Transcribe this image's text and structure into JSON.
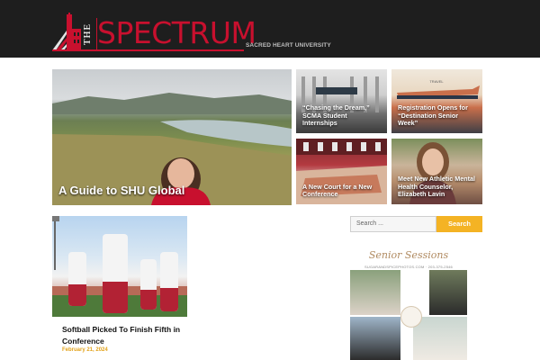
{
  "site": {
    "logo_the": "THE",
    "logo_name": "SPECTRUM",
    "logo_sub": "SACRED HEART UNIVERSITY",
    "accent": "#c8102e",
    "header_bg": "#1e1e1e"
  },
  "featured": {
    "main": {
      "caption": "A Guide to SHU Global"
    },
    "tiles": [
      {
        "caption": "“Chasing the Dream,” SCMA Student Internships"
      },
      {
        "caption": "Registration Opens for “Destination Senior Week”"
      },
      {
        "caption": "A New Court for a New Conference"
      },
      {
        "caption": "Meet New Athletic Mental Health Counselor, Elizabeth Lavin"
      }
    ]
  },
  "post": {
    "title": "Softball Picked To Finish Fifth in Conference",
    "date": "February 21, 2024",
    "date_color": "#e2a21a"
  },
  "sidebar": {
    "search_placeholder": "Search ...",
    "search_button": "Search",
    "search_button_color": "#f4b324",
    "ad_title": "Senior Sessions",
    "ad_sub": "SUGARANDSPICEPHOTOS.COM · 203-375-2546"
  }
}
